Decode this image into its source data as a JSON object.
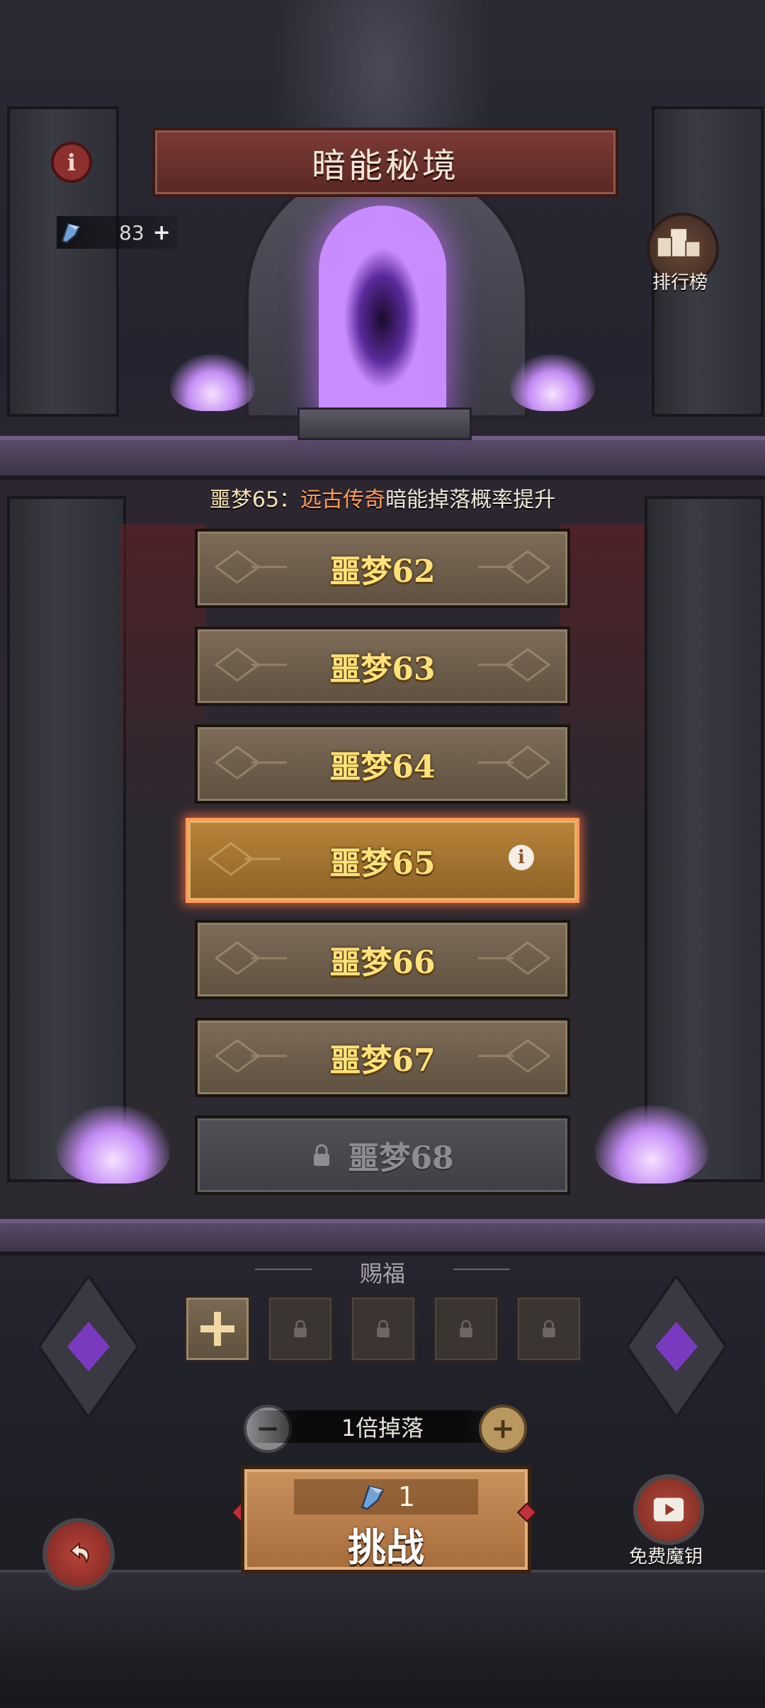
{
  "header": {
    "title": "暗能秘境",
    "key_count": "83",
    "key_plus": "+",
    "rank_label": "排行榜",
    "info_glyph": "i"
  },
  "drop_notice": {
    "prefix": "噩梦65：",
    "highlight": "远古传奇",
    "suffix": "暗能掉落概率提升"
  },
  "levels": [
    {
      "label": "噩梦62",
      "state": "normal"
    },
    {
      "label": "噩梦63",
      "state": "normal"
    },
    {
      "label": "噩梦64",
      "state": "normal"
    },
    {
      "label": "噩梦65",
      "state": "selected"
    },
    {
      "label": "噩梦66",
      "state": "normal"
    },
    {
      "label": "噩梦67",
      "state": "normal"
    },
    {
      "label": "噩梦68",
      "state": "locked"
    }
  ],
  "blessing": {
    "title": "赐福",
    "slots": [
      "add",
      "locked",
      "locked",
      "locked",
      "locked"
    ]
  },
  "multiplier": {
    "label": "1倍掉落",
    "minus": "−",
    "plus": "+"
  },
  "challenge": {
    "cost": "1",
    "label": "挑战"
  },
  "free_key": {
    "label": "免费魔钥"
  },
  "icons": {
    "info": "info-icon",
    "key": "key-icon",
    "rank": "podium-icon",
    "lock": "lock-icon",
    "back": "back-arrow-icon",
    "video": "video-play-icon"
  },
  "colors": {
    "level_text": "#ffe27a",
    "highlight": "#ff9b52",
    "selected_border": "#ff9a58",
    "portal": "#c98cff"
  }
}
